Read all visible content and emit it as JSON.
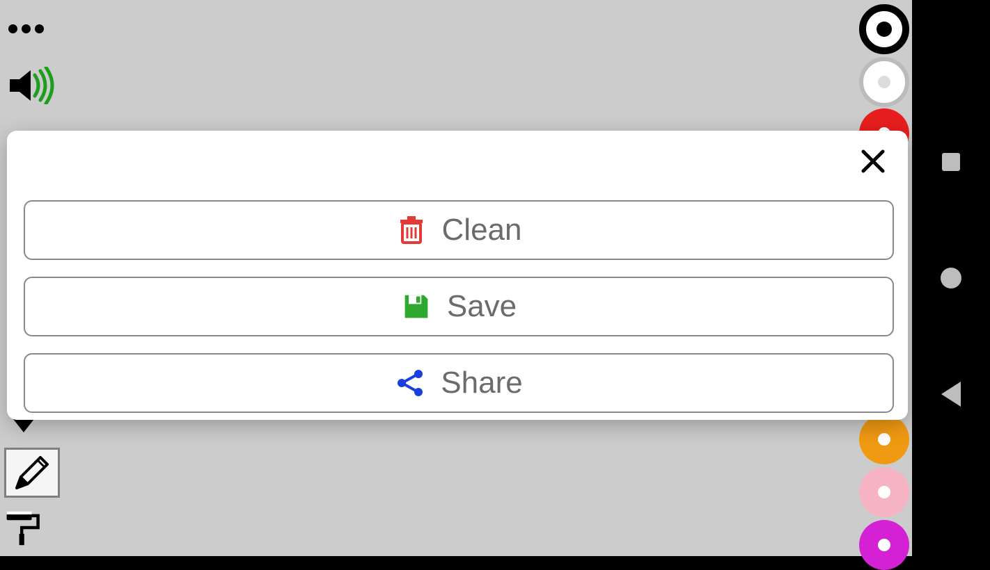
{
  "modal": {
    "clean_label": "Clean",
    "save_label": "Save",
    "share_label": "Share"
  },
  "colors": {
    "selected": "#000000",
    "white": "#ffffff",
    "red": "#e81e1e",
    "orange": "#f09a12",
    "pink": "#f5b3c3",
    "magenta": "#d321d3"
  },
  "icons": {
    "trash_color": "#e53935",
    "save_color": "#2fa82f",
    "share_color": "#1a3fe0",
    "sound_color": "#1e9e1e"
  }
}
